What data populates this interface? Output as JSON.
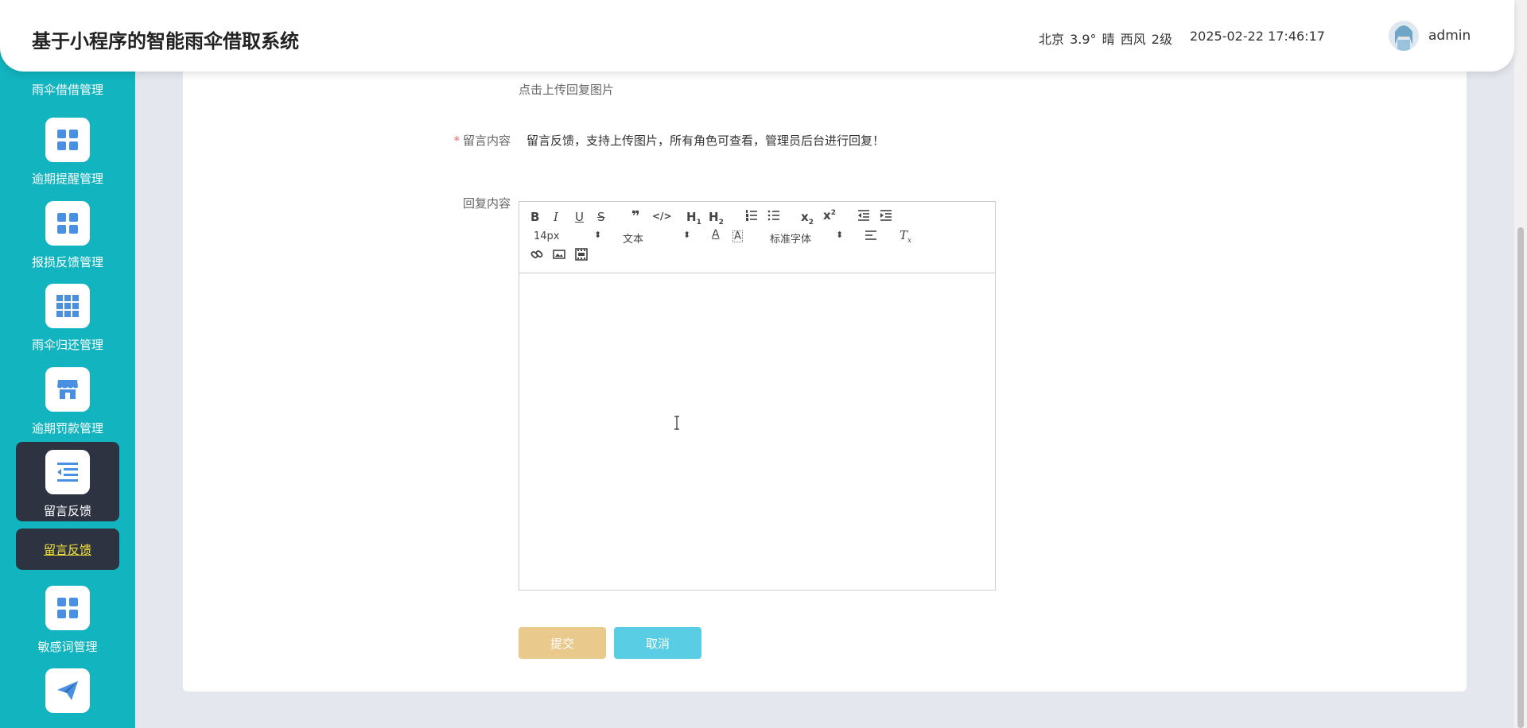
{
  "header": {
    "title": "基于小程序的智能雨伞借取系统",
    "weather": "北京 3.9° 晴 西风 2级",
    "datetime": "2025-02-22 17:46:17",
    "username": "admin"
  },
  "sidebar": {
    "cut_label": "雨伞借借管理",
    "items": [
      {
        "label": "逾期提醒管理",
        "icon": "grid-icon"
      },
      {
        "label": "报损反馈管理",
        "icon": "grid-icon"
      },
      {
        "label": "雨伞归还管理",
        "icon": "grid9-icon"
      },
      {
        "label": "逾期罚款管理",
        "icon": "store-icon"
      },
      {
        "label": "留言反馈",
        "icon": "list-icon"
      },
      {
        "label": "敏感词管理",
        "icon": "grid-icon"
      },
      {
        "label": "",
        "icon": "send-icon"
      }
    ],
    "sub_item": "留言反馈"
  },
  "form": {
    "upload_hint": "点击上传回复图片",
    "content_label": "留言内容",
    "content_value": "留言反馈，支持上传图片，所有角色可查看，管理员后台进行回复！",
    "reply_label": "回复内容"
  },
  "editor": {
    "font_size": "14px",
    "block_type": "文本",
    "font_family": "标准字体"
  },
  "buttons": {
    "submit": "提交",
    "cancel": "取消"
  },
  "colors": {
    "sidebar": "#11b4bf",
    "sidebar_active": "#2d3341",
    "submit": "#eac98c",
    "cancel": "#58cde3",
    "icon_blue": "#4a90e2"
  }
}
